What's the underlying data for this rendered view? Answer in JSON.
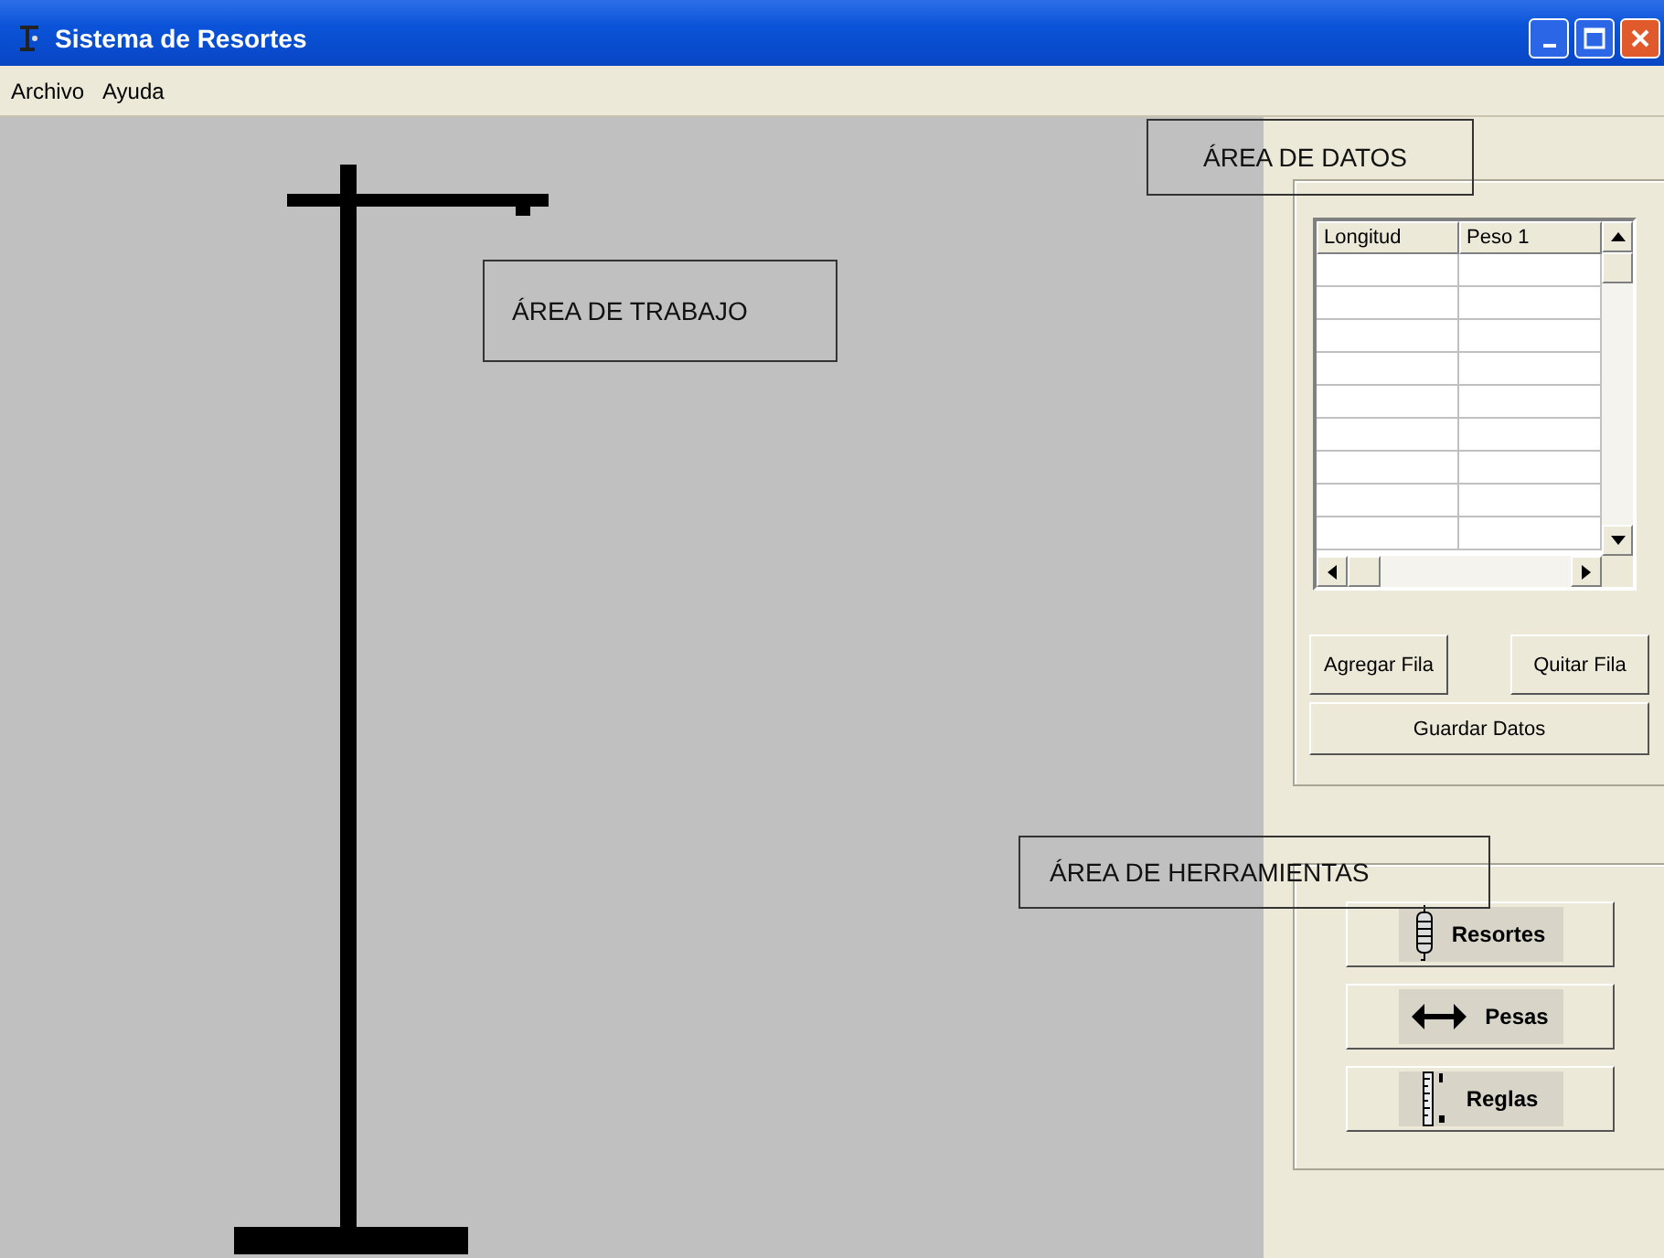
{
  "window": {
    "title": "Sistema de Resortes"
  },
  "menu": [
    "Archivo",
    "Ayuda"
  ],
  "annotations": [
    {
      "text": "ÁREA DE DATOS",
      "kind": "data"
    },
    {
      "text": "ÁREA DE TRABAJO",
      "kind": "work"
    },
    {
      "text": "ÁREA DE HERRAMIENTAS",
      "kind": "tools"
    }
  ],
  "table": {
    "columns": [
      "Longitud",
      "Peso 1"
    ]
  },
  "data_buttons": [
    {
      "label": "Agregar Fila",
      "kind": "half"
    },
    {
      "label": "Quitar Fila",
      "kind": "half"
    },
    {
      "label": "Guardar Datos",
      "kind": "full"
    }
  ],
  "tools": [
    {
      "label": "Resortes",
      "kind": "spring"
    },
    {
      "label": "Pesas",
      "kind": "weight"
    },
    {
      "label": "Reglas",
      "kind": "ruler"
    }
  ]
}
